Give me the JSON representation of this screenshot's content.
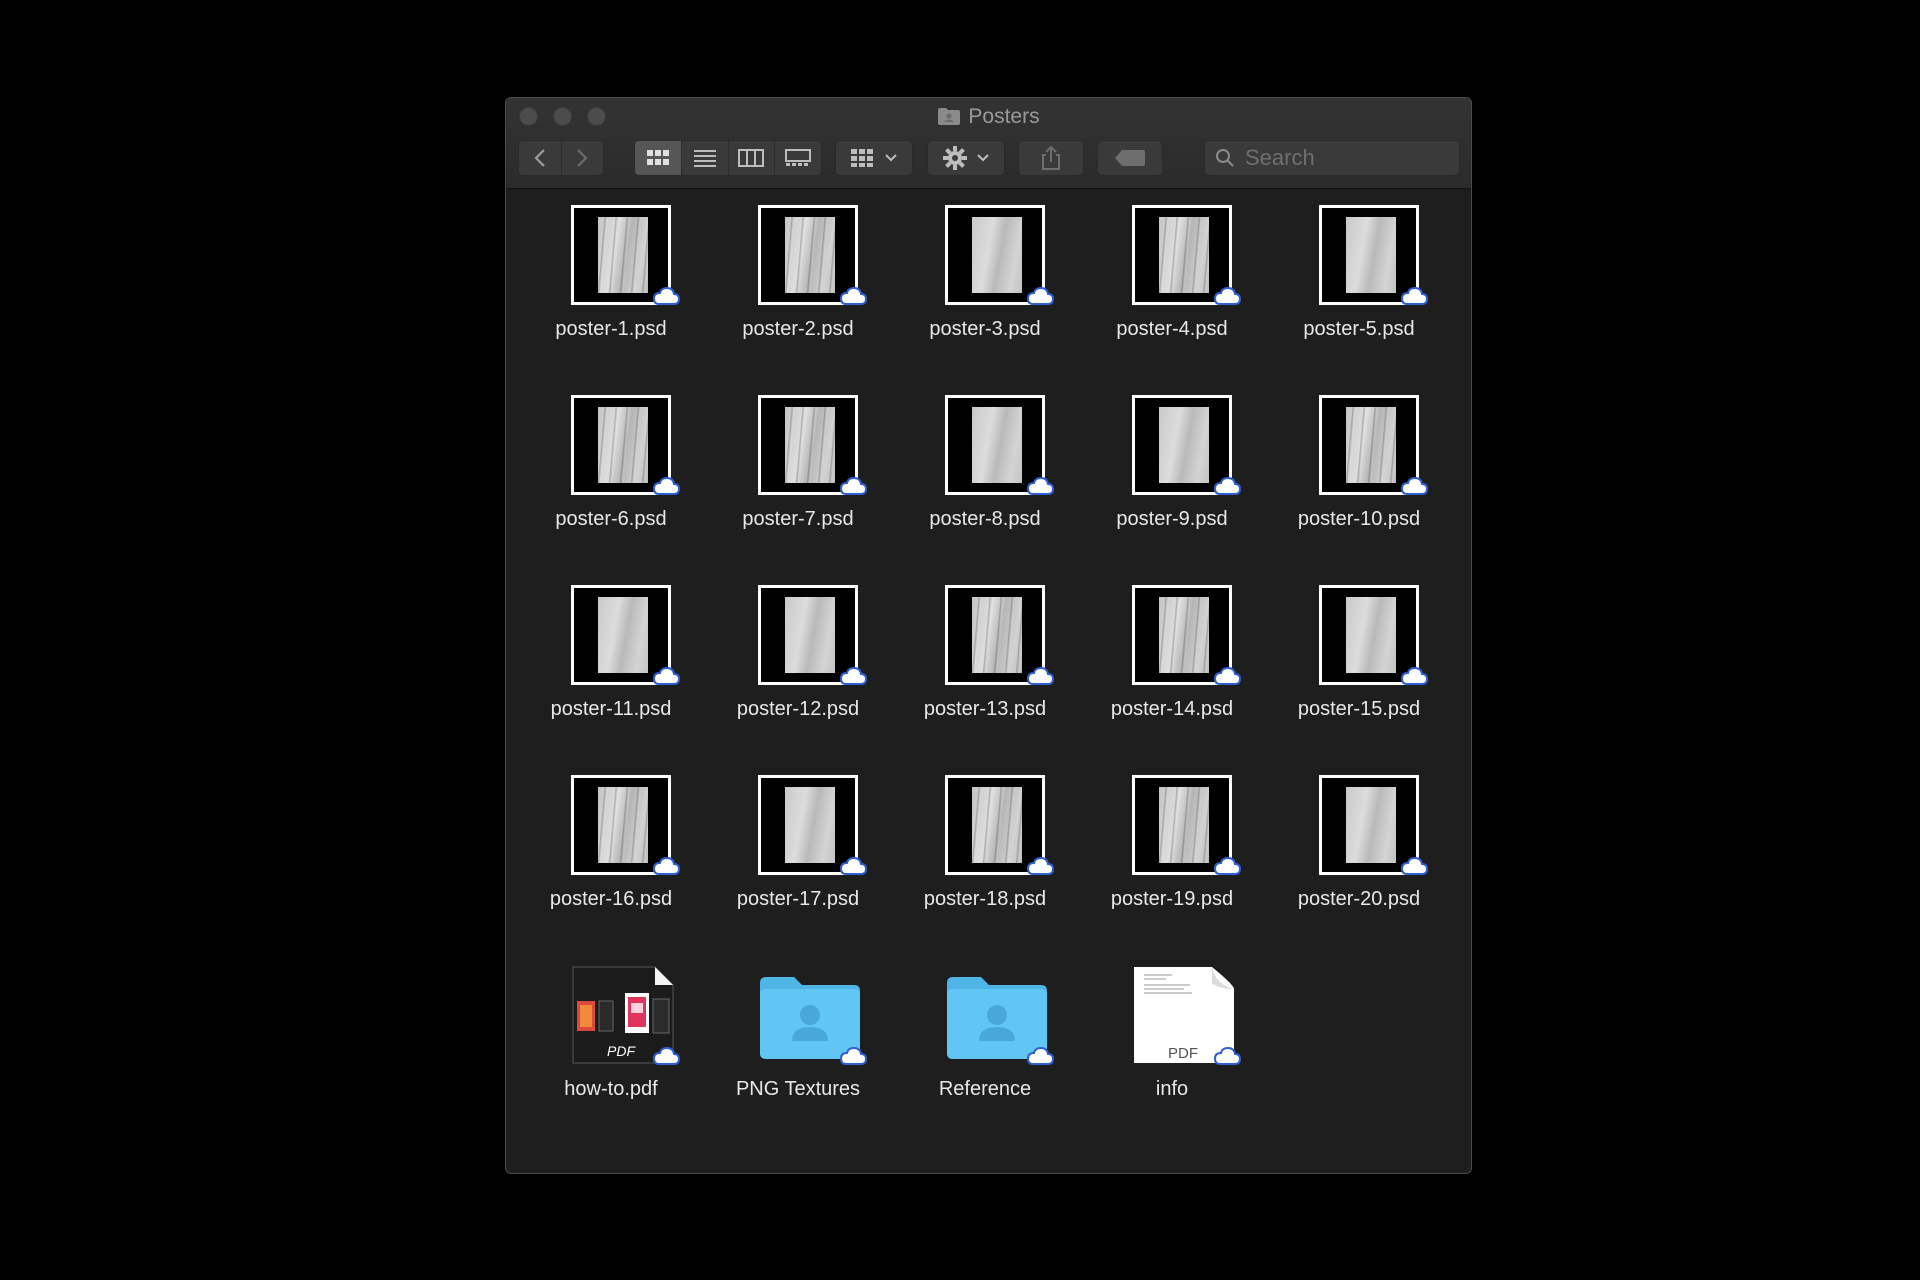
{
  "window": {
    "title": "Posters"
  },
  "toolbar": {
    "back_icon": "chevron-left-icon",
    "forward_icon": "chevron-right-icon",
    "view_modes": [
      "icon-view-icon",
      "list-view-icon",
      "column-view-icon",
      "gallery-view-icon"
    ],
    "active_view": "icon-view-icon",
    "group_icon": "group-by-icon",
    "action_icon": "gear-icon",
    "share_icon": "share-icon",
    "tag_icon": "tag-icon",
    "search_placeholder": "Search"
  },
  "colors": {
    "window_bg": "#1e1e1e",
    "toolbar_bg": "#333333",
    "folder_blue": "#5ac8fa",
    "cloud_blue": "#2f5fd0"
  },
  "items": [
    {
      "name": "poster-1.psd",
      "kind": "poster",
      "cloud": true
    },
    {
      "name": "poster-2.psd",
      "kind": "poster",
      "cloud": true
    },
    {
      "name": "poster-3.psd",
      "kind": "poster",
      "cloud": true
    },
    {
      "name": "poster-4.psd",
      "kind": "poster",
      "cloud": true
    },
    {
      "name": "poster-5.psd",
      "kind": "poster",
      "cloud": true
    },
    {
      "name": "poster-6.psd",
      "kind": "poster",
      "cloud": true
    },
    {
      "name": "poster-7.psd",
      "kind": "poster",
      "cloud": true
    },
    {
      "name": "poster-8.psd",
      "kind": "poster",
      "cloud": true
    },
    {
      "name": "poster-9.psd",
      "kind": "poster",
      "cloud": true
    },
    {
      "name": "poster-10.psd",
      "kind": "poster",
      "cloud": true
    },
    {
      "name": "poster-11.psd",
      "kind": "poster",
      "cloud": true
    },
    {
      "name": "poster-12.psd",
      "kind": "poster",
      "cloud": true
    },
    {
      "name": "poster-13.psd",
      "kind": "poster",
      "cloud": true
    },
    {
      "name": "poster-14.psd",
      "kind": "poster",
      "cloud": true
    },
    {
      "name": "poster-15.psd",
      "kind": "poster",
      "cloud": true
    },
    {
      "name": "poster-16.psd",
      "kind": "poster",
      "cloud": true
    },
    {
      "name": "poster-17.psd",
      "kind": "poster",
      "cloud": true
    },
    {
      "name": "poster-18.psd",
      "kind": "poster",
      "cloud": true
    },
    {
      "name": "poster-19.psd",
      "kind": "poster",
      "cloud": true
    },
    {
      "name": "poster-20.psd",
      "kind": "poster",
      "cloud": true
    },
    {
      "name": "how-to.pdf",
      "kind": "pdf-preview",
      "cloud": true,
      "badge": "PDF"
    },
    {
      "name": "PNG Textures",
      "kind": "folder",
      "cloud": true
    },
    {
      "name": "Reference",
      "kind": "folder",
      "cloud": true
    },
    {
      "name": "info",
      "kind": "pdf",
      "cloud": true,
      "badge": "PDF"
    }
  ]
}
